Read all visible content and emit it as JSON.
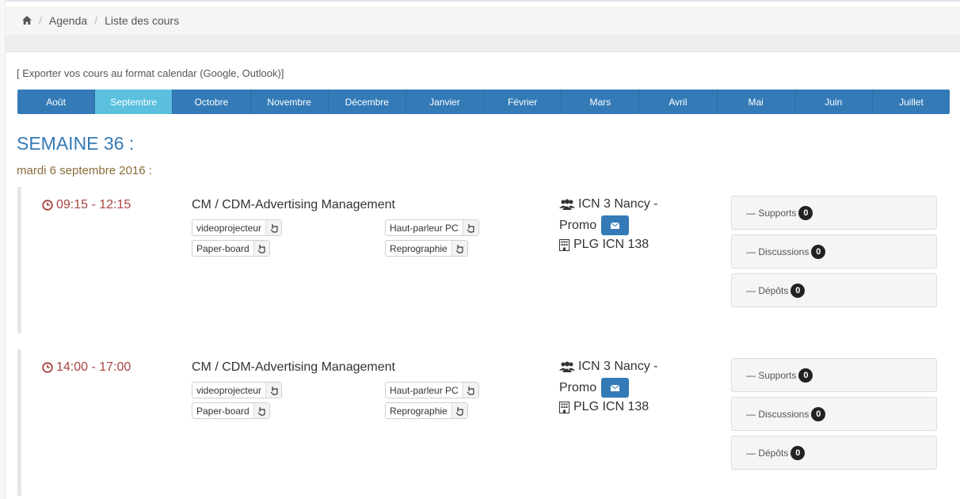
{
  "breadcrumb": {
    "icon": "home-icon",
    "items": [
      "Agenda",
      "Liste des cours"
    ]
  },
  "export_link": "[ Exporter vos cours au format calendar (Google, Outlook)]",
  "months": [
    "Août",
    "Septembre",
    "Octobre",
    "Novembre",
    "Décembre",
    "Janvier",
    "Février",
    "Mars",
    "Avril",
    "Mai",
    "Juin",
    "Juillet"
  ],
  "active_month": "Septembre",
  "week_title": "SEMAINE 36 :",
  "day_title": "mardi 6 septembre 2016 :",
  "colors": {
    "primary": "#337ab7",
    "active_tab": "#5bc0de",
    "time": "#a94442",
    "day": "#8a6d3b"
  },
  "courses": [
    {
      "time": "09:15 - 12:15",
      "title": "CM / CDM-Advertising Management",
      "equipment": [
        "videoprojecteur",
        "Haut-parleur PC",
        "Paper-board",
        "Reprographie"
      ],
      "group_line1": "ICN 3 Nancy -",
      "group_line2": "Promo",
      "room": "PLG ICN 138",
      "panels": [
        {
          "label": "— Supports",
          "count": "0"
        },
        {
          "label": "— Discussions",
          "count": "0"
        },
        {
          "label": "— Dépôts",
          "count": "0"
        }
      ]
    },
    {
      "time": "14:00 - 17:00",
      "title": "CM / CDM-Advertising Management",
      "equipment": [
        "videoprojecteur",
        "Haut-parleur PC",
        "Paper-board",
        "Reprographie"
      ],
      "group_line1": "ICN 3 Nancy -",
      "group_line2": "Promo",
      "room": "PLG ICN 138",
      "panels": [
        {
          "label": "— Supports",
          "count": "0"
        },
        {
          "label": "— Discussions",
          "count": "0"
        },
        {
          "label": "— Dépôts",
          "count": "0"
        }
      ]
    }
  ]
}
